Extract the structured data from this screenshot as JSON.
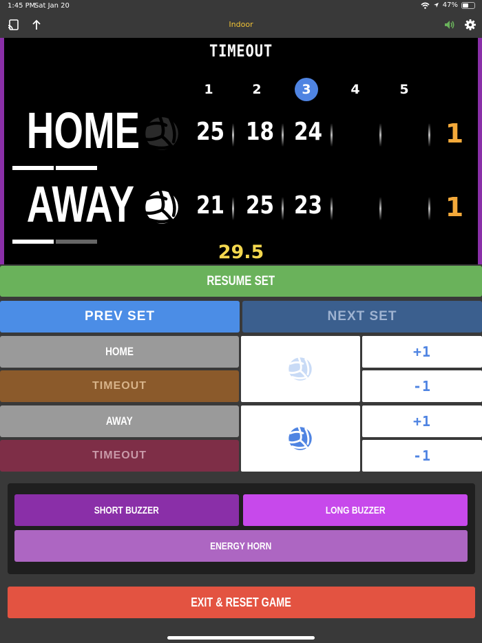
{
  "status": {
    "time": "1:45 PM",
    "date": "Sat Jan 20",
    "battery": "47%"
  },
  "nav": {
    "title": "Indoor",
    "icons": [
      "cast-icon",
      "share-icon",
      "speaker-icon",
      "gear-icon"
    ]
  },
  "board": {
    "title": "TIMEOUT",
    "sets": [
      "1",
      "2",
      "3",
      "4",
      "5"
    ],
    "current_set": 3,
    "home": {
      "name": "HOME",
      "scores": [
        "25",
        "18",
        "24",
        "",
        ""
      ],
      "sets_won": "1"
    },
    "away": {
      "name": "AWAY",
      "scores": [
        "21",
        "25",
        "23",
        "",
        ""
      ],
      "sets_won": "1"
    },
    "clock": "29.5"
  },
  "controls": {
    "resume": "RESUME SET",
    "prev": "PREV SET",
    "next": "NEXT SET",
    "home_label": "HOME",
    "home_timeout": "TIMEOUT",
    "away_label": "AWAY",
    "away_timeout": "TIMEOUT",
    "plus": "+1",
    "minus": "-1"
  },
  "buzzers": {
    "short": "SHORT BUZZER",
    "long": "LONG BUZZER",
    "horn": "ENERGY HORN"
  },
  "exit": "EXIT & RESET GAME",
  "colors": {
    "resume": "#6ab25b",
    "prev": "#4b8de6",
    "next": "#3b5f8e",
    "home_timeout": "#8b5a2b",
    "away_timeout": "#7e2e47",
    "short_buzzer": "#8a2fa8",
    "long_buzzer": "#c749eb",
    "energy_horn": "#ad66c2",
    "exit": "#e35341",
    "serve_accent": "#4f84e2",
    "sets_won": "#f3a93a"
  }
}
